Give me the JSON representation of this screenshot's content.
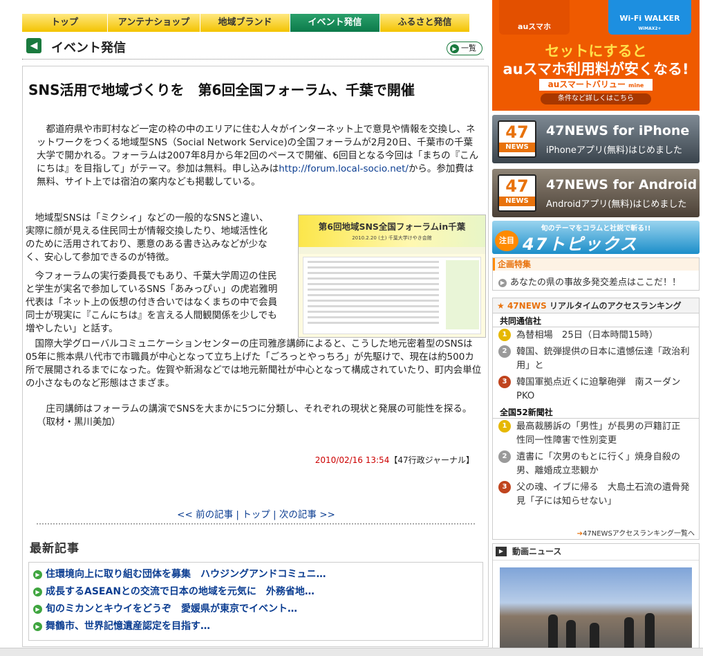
{
  "tabs": [
    "トップ",
    "アンテナショップ",
    "地域ブランド",
    "イベント発信",
    "ふるさと発信"
  ],
  "section_title": "イベント発信",
  "list_button": "一覧",
  "article": {
    "headline": "SNS活用で地域づくりを　第6回全国フォーラム、千葉で開催",
    "p1_a": "　都道府県や市町村など一定の枠の中のエリアに住む人々がインターネット上で意見や情報を交換し、ネットワークをつくる地域型SNS（Social Network Service)の全国フォーラムが2月20日、千葉市の千葉大学で開かれる。フォーラムは2007年8月から年2回のペースで開催、6回目となる今回は「まちの『こんにちは』を目指して」がテーマ。参加は無料。申し込みは",
    "p1_link": "http://forum.local-socio.net/",
    "p1_b": "から。参加費は無料、サイト上では宿泊の案内なども掲載している。",
    "p2": "　地域型SNSは「ミクシィ」などの一般的なSNSと違い、実際に顔が見える住民同士が情報交換したり、地域活性化のために活用されており、悪意のある書き込みなどが少なく、安心して参加できるのが特徴。",
    "p3": "　今フォーラムの実行委員長でもあり、千葉大学周辺の住民と学生が実名で参加しているSNS「あみっぴぃ」の虎岩雅明代表は「ネット上の仮想の付き合いではなくまちの中で会員同士が現実に『こんにちは』を言える人間観関係を少しでも増やしたい」と話す。",
    "p4": "　国際大学グローバルコミュニケーションセンターの庄司雅彦講師によると、こうした地元密着型のSNSは05年に熊本県八代市で市職員が中心となって立ち上げた「ごろっとやっちろ」が先駆けで、現在は約500カ所で展開されるまでになった。佐賀や新潟などでは地元新聞社が中心となって構成されていたり、町内会単位の小さなものなど形態はさまざま。",
    "p5": "　庄司講師はフォーラムの講演でSNSを大まかに5つに分類し、それぞれの現状と発展の可能性を探る。（取材・黒川美加）",
    "figure_title": "第6回地域SNS全国フォーラムin千葉",
    "figure_sub": "2010.2.20 (土) 千葉大学けやき会館",
    "date": "2010/02/16 13:54",
    "source": "【47行政ジャーナル】"
  },
  "article_nav": {
    "prev": "<< 前の記事",
    "top": "トップ",
    "next": "次の記事 >>",
    "sep": "|"
  },
  "latest": {
    "title": "最新記事",
    "items": [
      "住環境向上に取り組む団体を募集　ハウジングアンドコミュニ…",
      "成長するASEANとの交流で日本の地域を元気に　外務省地…",
      "旬のミカンとキウイをどうぞ　愛媛県が東京でイベント…",
      "舞鶴市、世界記憶遺産認定を目指す…"
    ]
  },
  "sidebar": {
    "ad": {
      "left": "auスマホ",
      "right": "Wi-Fi WALKER",
      "right_small": "WiMAX2+",
      "line1": "セットにすると",
      "line2": "auスマホ利用料が安くなる!",
      "line3": "auスマートバリュー",
      "line3_small": "mine",
      "line4": "条件など詳しくはこちら"
    },
    "iphone": {
      "badge_num": "47",
      "badge_word": "NEWS",
      "name": "47NEWS for iPhone",
      "sub": "iPhoneアプリ(無料)はじめました"
    },
    "android": {
      "badge_num": "47",
      "badge_word": "NEWS",
      "name": "47NEWS for Android",
      "sub": "Androidアプリ(無料)はじめました"
    },
    "topics": {
      "label": "旬のテーマをコラムと社説で斬る!!",
      "badge": "注目",
      "name": "47トピックス"
    },
    "kikaku": {
      "header": "企画特集",
      "item": "あなたの県の事故多発交差点はここだ！！"
    },
    "ranking": {
      "header_47": "47NEWS",
      "header_rest": " リアルタイムのアクセスランキング",
      "sec1": "共同通信社",
      "sec1_items": [
        "為替相場　25日（日本時間15時）",
        "韓国、銃弾提供の日本に遺憾伝達「政治利用」と",
        "韓国軍拠点近くに迫撃砲弾　南スーダンPKO"
      ],
      "sec2": "全国52新聞社",
      "sec2_items": [
        "最高裁勝訴の「男性」が長男の戸籍訂正　性同一性障害で性別変更",
        "遺書に「次男のもとに行く」焼身自殺の男、離婚成立悲観か",
        "父の魂、イブに帰る　大島土石流の遺骨発見「子には知らせない」"
      ],
      "more": "47NEWSアクセスランキング一覧へ"
    },
    "video": {
      "header": "動画ニュース"
    }
  }
}
